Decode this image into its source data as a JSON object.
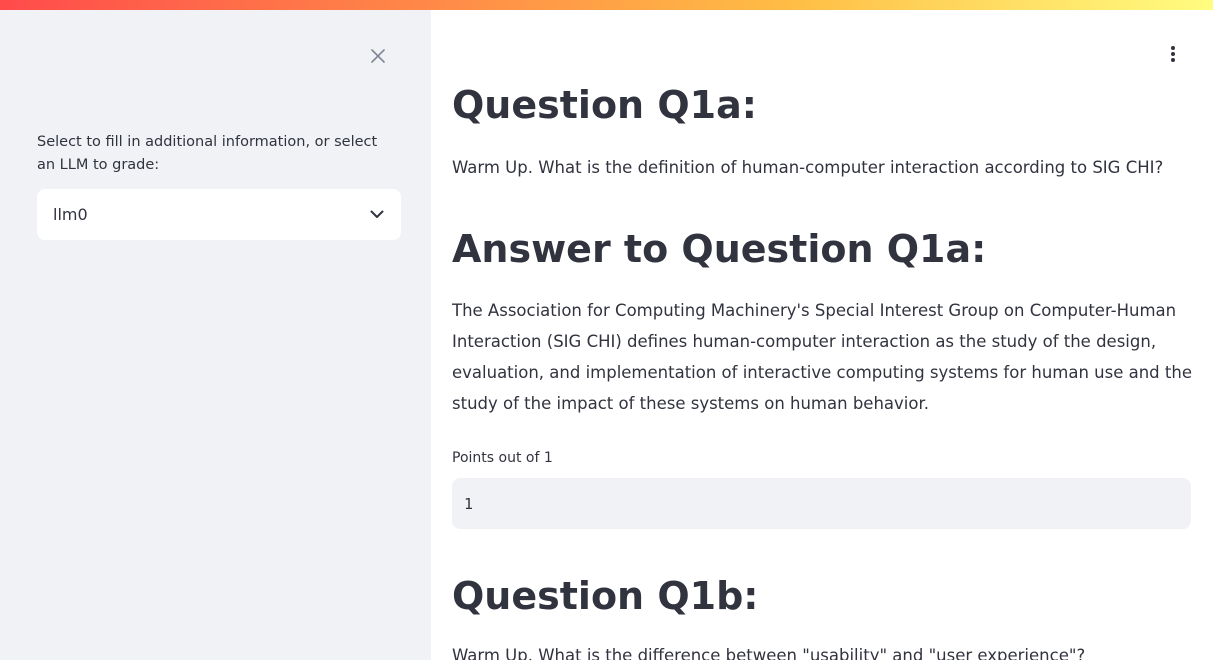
{
  "sidebar": {
    "label": "Select to fill in additional information, or select an LLM to grade:",
    "select": {
      "value": "llm0"
    },
    "close_icon": "close-icon",
    "chevron_icon": "chevron-down-icon"
  },
  "main": {
    "menu_icon": "vertical-dots-icon",
    "sections": {
      "q1a_heading": "Question Q1a:",
      "q1a_text": "Warm Up. What is the definition of human-computer interaction according to SIG CHI?",
      "answer_heading": "Answer to Question Q1a:",
      "answer_text": "The Association for Computing Machinery's Special Interest Group on Computer-Human Interaction (SIG CHI) defines human-computer interaction as the study of the design, evaluation, and implementation of interactive computing systems for human use and the study of the impact of these systems on human behavior.",
      "points_label": "Points out of 1",
      "points_value": "1",
      "q1b_heading": "Question Q1b:",
      "q1b_text": "Warm Up. What is the difference between \"usability\" and \"user experience\"?"
    }
  },
  "colors": {
    "sidebar_bg": "#f0f2f6",
    "text": "#31333f",
    "input_bg": "#f0f2f6",
    "accent_start": "#ff4b4b",
    "accent_end": "#fffd80"
  }
}
